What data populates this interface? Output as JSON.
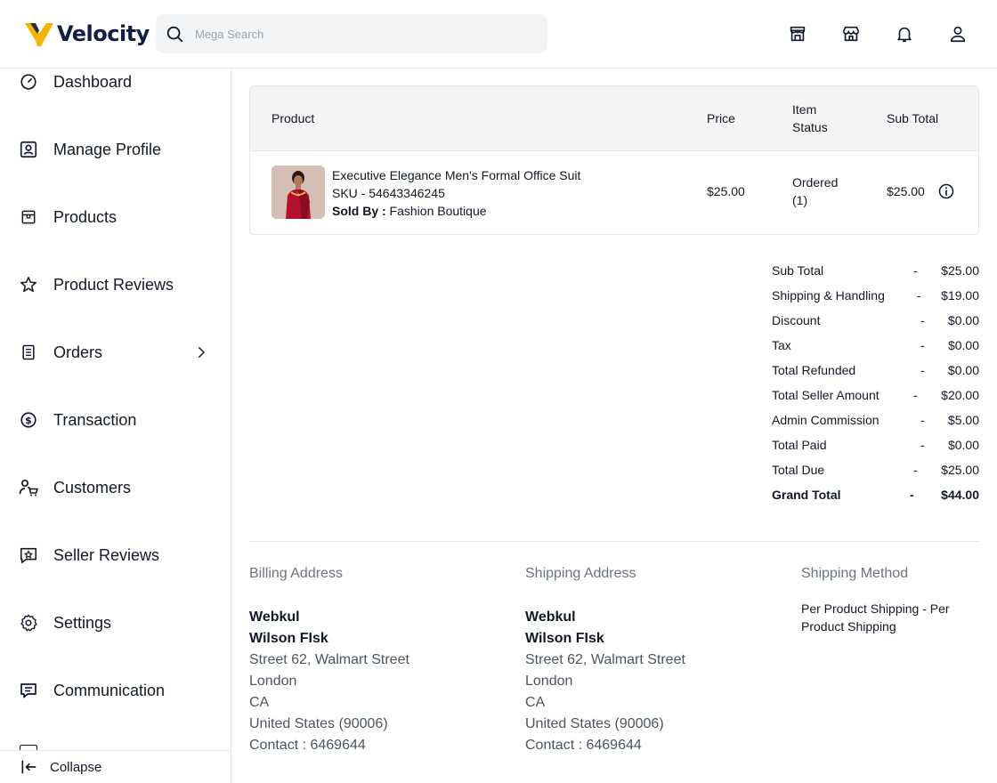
{
  "app": {
    "name": "Velocity"
  },
  "search": {
    "placeholder": "Mega Search"
  },
  "header_icons": [
    "storefront-icon",
    "shop-icon",
    "bell-icon",
    "user-icon"
  ],
  "sidebar": {
    "items": [
      {
        "label": "Dashboard",
        "icon": "gauge-icon"
      },
      {
        "label": "Manage Profile",
        "icon": "profile-card-icon"
      },
      {
        "label": "Products",
        "icon": "box-icon"
      },
      {
        "label": "Product Reviews",
        "icon": "star-icon"
      },
      {
        "label": "Orders",
        "icon": "document-icon",
        "has_submenu": true
      },
      {
        "label": "Transaction",
        "icon": "dollar-circle-icon"
      },
      {
        "label": "Customers",
        "icon": "customer-cart-icon"
      },
      {
        "label": "Seller Reviews",
        "icon": "review-star-icon"
      },
      {
        "label": "Settings",
        "icon": "gear-icon"
      },
      {
        "label": "Communication",
        "icon": "chat-icon"
      }
    ],
    "collapse_label": "Collapse"
  },
  "order_table": {
    "headers": {
      "product": "Product",
      "price": "Price",
      "item_status_1": "Item",
      "item_status_2": "Status",
      "sub_total": "Sub Total"
    },
    "rows": [
      {
        "name": "Executive Elegance Men's Formal Office Suit",
        "sku": "SKU - 54643346245",
        "sold_by_label": "Sold By :",
        "sold_by": " Fashion Boutique",
        "price": "$25.00",
        "status_1": "Ordered",
        "status_2": "(1)",
        "sub_total": "$25.00"
      }
    ]
  },
  "totals": [
    {
      "label": "Sub Total",
      "sep": "-",
      "value": "$25.00"
    },
    {
      "label": "Shipping & Handling",
      "sep": "-",
      "value": "$19.00"
    },
    {
      "label": "Discount",
      "sep": "-",
      "value": "$0.00"
    },
    {
      "label": "Tax",
      "sep": "-",
      "value": "$0.00"
    },
    {
      "label": "Total Refunded",
      "sep": "-",
      "value": "$0.00"
    },
    {
      "label": "Total Seller Amount",
      "sep": "-",
      "value": "$20.00"
    },
    {
      "label": "Admin Commission",
      "sep": "-",
      "value": "$5.00"
    },
    {
      "label": "Total Paid",
      "sep": "-",
      "value": "$0.00"
    },
    {
      "label": "Total Due",
      "sep": "-",
      "value": "$25.00"
    },
    {
      "label": "Grand Total",
      "sep": "-",
      "value": "$44.00"
    }
  ],
  "billing": {
    "title": "Billing Address",
    "company": "Webkul",
    "name": "Wilson FIsk",
    "street": "Street 62, Walmart Street",
    "city": "London",
    "state": "CA",
    "country": "United States (90006)",
    "contact": "Contact : 6469644"
  },
  "shipping": {
    "title": "Shipping Address",
    "company": "Webkul",
    "name": "Wilson FIsk",
    "street": "Street 62, Walmart Street",
    "city": "London",
    "state": "CA",
    "country": "United States (90006)",
    "contact": "Contact : 6469644"
  },
  "shipping_method": {
    "title": "Shipping Method",
    "value": "Per Product Shipping - Per Product Shipping"
  },
  "colors": {
    "brand_dark": "#0f1e46",
    "logo_gold": "#f5b400",
    "border": "#e5e7eb",
    "muted": "#6b7280"
  }
}
